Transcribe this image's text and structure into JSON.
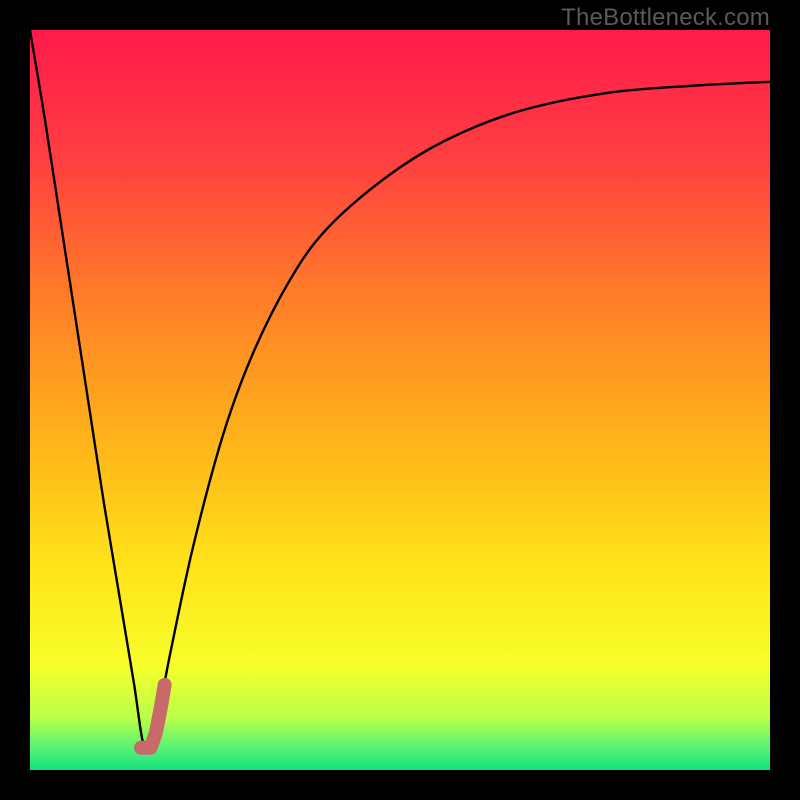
{
  "watermark": "TheBottleneck.com",
  "colors": {
    "frame": "#000000",
    "curve": "#000000",
    "marker": "#c86a6a",
    "gradient_stops": [
      {
        "offset": 0.0,
        "color": "#ff1a4b"
      },
      {
        "offset": 0.18,
        "color": "#ff4040"
      },
      {
        "offset": 0.35,
        "color": "#ff7a2a"
      },
      {
        "offset": 0.55,
        "color": "#ffb21a"
      },
      {
        "offset": 0.72,
        "color": "#ffe21a"
      },
      {
        "offset": 0.86,
        "color": "#f7ff2a"
      },
      {
        "offset": 0.93,
        "color": "#b8ff4a"
      },
      {
        "offset": 0.975,
        "color": "#4cf07a"
      },
      {
        "offset": 1.0,
        "color": "#14e27a"
      }
    ]
  },
  "chart_data": {
    "type": "line",
    "title": "",
    "xlabel": "",
    "ylabel": "",
    "xlim": [
      0,
      100
    ],
    "ylim": [
      0,
      100
    ],
    "axes_visible": false,
    "series": [
      {
        "name": "bottleneck-curve",
        "x": [
          0,
          2,
          4,
          6,
          8,
          10,
          12,
          14,
          15.5,
          17,
          19,
          22,
          26,
          30,
          35,
          40,
          48,
          56,
          66,
          78,
          90,
          100
        ],
        "values": [
          100,
          88,
          75,
          62,
          49,
          36,
          24,
          12,
          3,
          6,
          16,
          30,
          45,
          56,
          66,
          73,
          80,
          85,
          89,
          91.5,
          92.5,
          93
        ]
      }
    ],
    "marker": {
      "name": "selected-point",
      "path_xy": [
        [
          15.0,
          3.0
        ],
        [
          16.3,
          3.0
        ],
        [
          17.0,
          5.0
        ],
        [
          17.6,
          8.0
        ],
        [
          18.2,
          11.5
        ]
      ],
      "stroke_width": 14
    }
  }
}
